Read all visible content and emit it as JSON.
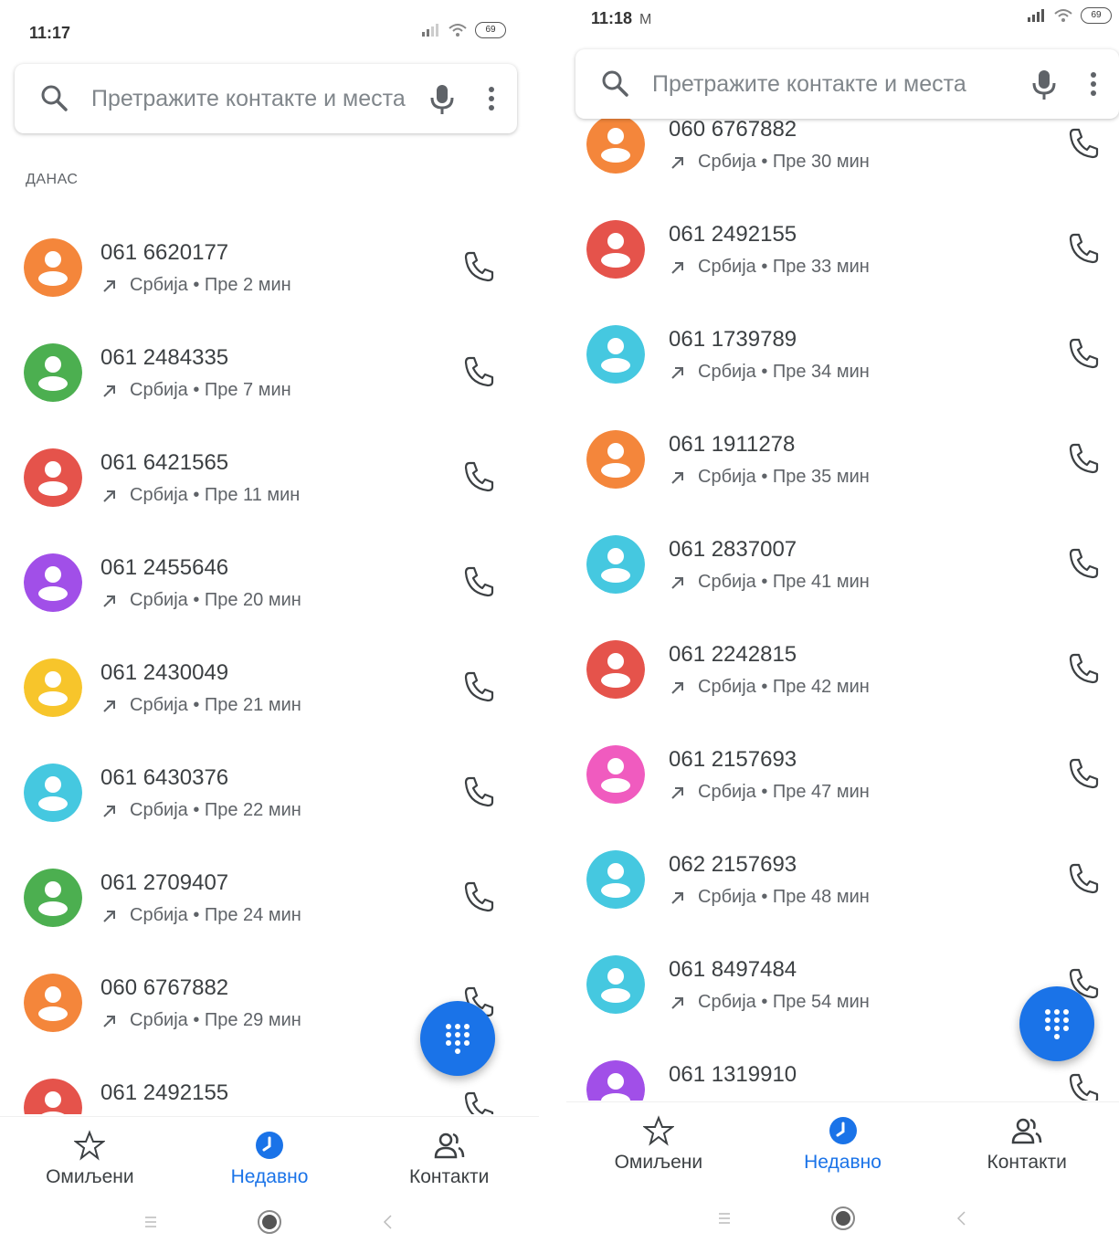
{
  "colors": {
    "accent": "#1a73e8",
    "orange": "#f4863b",
    "green": "#4caf50",
    "red": "#e5534b",
    "purple": "#a14fe8",
    "yellow": "#f7c52b",
    "cyan": "#45c8e0",
    "pink": "#f05bbf"
  },
  "left": {
    "status": {
      "time": "11:17",
      "battery": "69"
    },
    "search": {
      "placeholder": "Претражите контакте и места"
    },
    "section": "ДАНАС",
    "calls": [
      {
        "number": "061 6620177",
        "detail": "Србија • Пре 2 мин",
        "color": "orange"
      },
      {
        "number": "061 2484335",
        "detail": "Србија • Пре 7 мин",
        "color": "green"
      },
      {
        "number": "061 6421565",
        "detail": "Србија • Пре 11 мин",
        "color": "red"
      },
      {
        "number": "061 2455646",
        "detail": "Србија • Пре 20 мин",
        "color": "purple"
      },
      {
        "number": "061 2430049",
        "detail": "Србија • Пре 21 мин",
        "color": "yellow"
      },
      {
        "number": "061 6430376",
        "detail": "Србија • Пре 22 мин",
        "color": "cyan"
      },
      {
        "number": "061 2709407",
        "detail": "Србија • Пре 24 мин",
        "color": "green"
      },
      {
        "number": "060 6767882",
        "detail": "Србија • Пре 29 мин",
        "color": "orange"
      },
      {
        "number": "061 2492155",
        "detail": "",
        "color": "red"
      }
    ],
    "nav": {
      "favorites": "Омиљени",
      "recents": "Недавно",
      "contacts": "Контакти"
    }
  },
  "right": {
    "status": {
      "time": "11:18",
      "mail_icon": "M",
      "battery": "69"
    },
    "search": {
      "placeholder": "Претражите контакте и места"
    },
    "calls": [
      {
        "number": "060 6767882",
        "detail": "Србија • Пре 30 мин",
        "color": "orange"
      },
      {
        "number": "061 2492155",
        "detail": "Србија • Пре 33 мин",
        "color": "red"
      },
      {
        "number": "061 1739789",
        "detail": "Србија • Пре 34 мин",
        "color": "cyan"
      },
      {
        "number": "061 1911278",
        "detail": "Србија • Пре 35 мин",
        "color": "orange"
      },
      {
        "number": "061 2837007",
        "detail": "Србија • Пре 41 мин",
        "color": "cyan"
      },
      {
        "number": "061 2242815",
        "detail": "Србија • Пре 42 мин",
        "color": "red"
      },
      {
        "number": "061 2157693",
        "detail": "Србија • Пре 47 мин",
        "color": "pink"
      },
      {
        "number": "062 2157693",
        "detail": "Србија • Пре 48 мин",
        "color": "cyan"
      },
      {
        "number": "061 8497484",
        "detail": "Србија • Пре 54 мин",
        "color": "cyan"
      },
      {
        "number": "061 1319910",
        "detail": "",
        "color": "purple"
      }
    ],
    "nav": {
      "favorites": "Омиљени",
      "recents": "Недавно",
      "contacts": "Контакти"
    }
  }
}
